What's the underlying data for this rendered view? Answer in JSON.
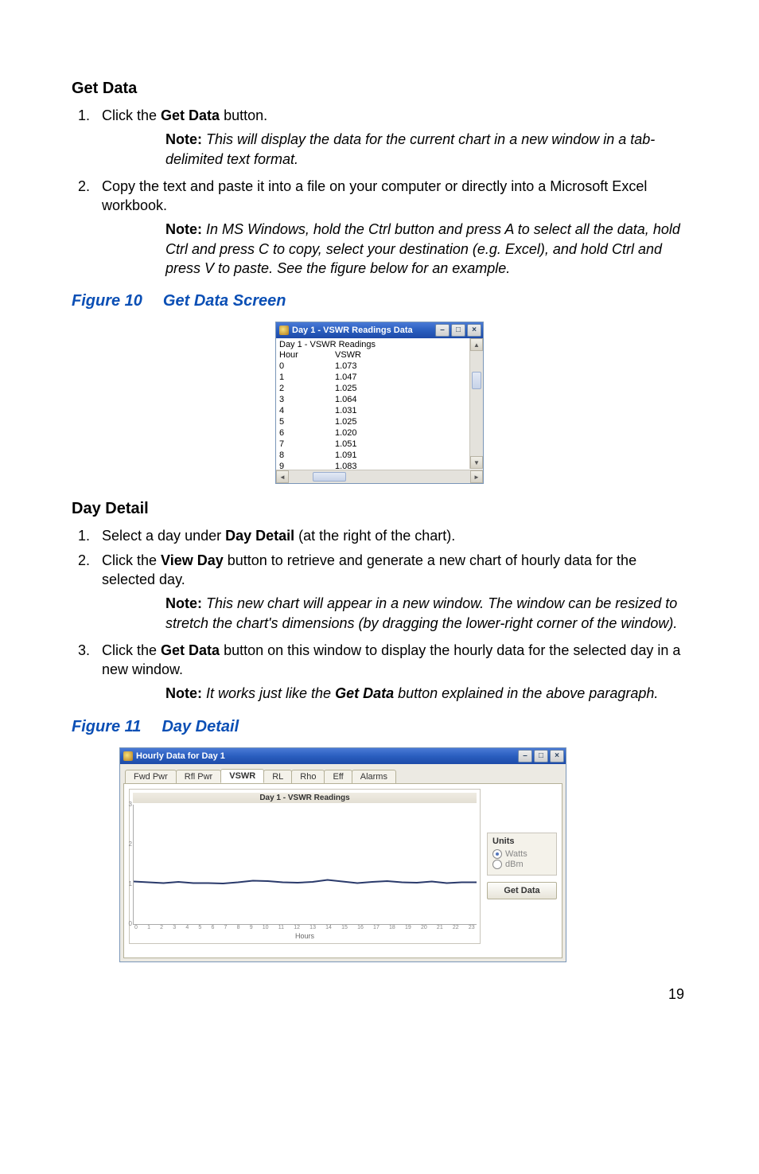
{
  "section1": {
    "heading": "Get Data",
    "steps": [
      {
        "pre": "Click the ",
        "bold": "Get Data",
        "post": " button.",
        "note": "This will display the data for the current chart in a new window in a tab-delimited text format."
      },
      {
        "text": "Copy the text and paste it into a file on your computer or directly into a Microsoft Excel workbook.",
        "note": "In MS Windows, hold the Ctrl button and press A to select all the data, hold Ctrl and press C to copy, select your destination (e.g. Excel), and hold Ctrl and press V to paste. See the figure below for an example."
      }
    ]
  },
  "note_label": "Note:",
  "figure10": {
    "num": "Figure 10",
    "title": "Get Data Screen",
    "window_title": "Day 1 - VSWR Readings Data",
    "header": "Day 1 - VSWR Readings",
    "col1": "Hour",
    "col2": "VSWR",
    "rows": [
      [
        "0",
        "1.073"
      ],
      [
        "1",
        "1.047"
      ],
      [
        "2",
        "1.025"
      ],
      [
        "3",
        "1.064"
      ],
      [
        "4",
        "1.031"
      ],
      [
        "5",
        "1.025"
      ],
      [
        "6",
        "1.020"
      ],
      [
        "7",
        "1.051"
      ],
      [
        "8",
        "1.091"
      ],
      [
        "9",
        "1.083"
      ]
    ]
  },
  "section2": {
    "heading": "Day Detail",
    "step1_pre": "Select a day under ",
    "step1_bold": "Day Detail",
    "step1_post": " (at the right of the chart).",
    "step2_pre": "Click the ",
    "step2_bold": "View Day",
    "step2_post": " button to retrieve and generate a new chart of hourly data for the selected day.",
    "step2_note": "This new chart will appear in a new window. The window can be resized to stretch the chart's dimensions (by dragging the lower-right corner of the window).",
    "step3_pre": "Click the ",
    "step3_bold": "Get Data",
    "step3_post": " button on this window to display the hourly data for the selected day in a new window.",
    "step3_note_pre": "It works just like the ",
    "step3_note_bold": "Get Data",
    "step3_note_post": " button explained in the above paragraph."
  },
  "figure11": {
    "num": "Figure 11",
    "title": "Day Detail",
    "window_title": "Hourly Data for Day 1",
    "tabs": [
      "Fwd Pwr",
      "Rfl Pwr",
      "VSWR",
      "RL",
      "Rho",
      "Eff",
      "Alarms"
    ],
    "active_tab_index": 2,
    "chart_title": "Day 1 - VSWR Readings",
    "yticks": [
      "3",
      "2",
      "1",
      "0"
    ],
    "xticks": [
      "0",
      "1",
      "2",
      "3",
      "4",
      "5",
      "6",
      "7",
      "8",
      "9",
      "10",
      "11",
      "12",
      "13",
      "14",
      "15",
      "16",
      "17",
      "18",
      "19",
      "20",
      "21",
      "22",
      "23"
    ],
    "xlabel": "Hours",
    "units_label": "Units",
    "unit_watts": "Watts",
    "unit_dbm": "dBm",
    "getdata_btn": "Get Data"
  },
  "chart_data": {
    "type": "line",
    "title": "Day 1 - VSWR Readings",
    "xlabel": "Hours",
    "ylabel": "",
    "ylim": [
      0,
      3
    ],
    "x": [
      0,
      1,
      2,
      3,
      4,
      5,
      6,
      7,
      8,
      9,
      10,
      11,
      12,
      13,
      14,
      15,
      16,
      17,
      18,
      19,
      20,
      21,
      22,
      23
    ],
    "values": [
      1.07,
      1.05,
      1.03,
      1.06,
      1.03,
      1.03,
      1.02,
      1.05,
      1.09,
      1.08,
      1.05,
      1.04,
      1.06,
      1.11,
      1.07,
      1.03,
      1.06,
      1.08,
      1.05,
      1.04,
      1.07,
      1.03,
      1.05,
      1.05
    ]
  },
  "pagenum": "19"
}
